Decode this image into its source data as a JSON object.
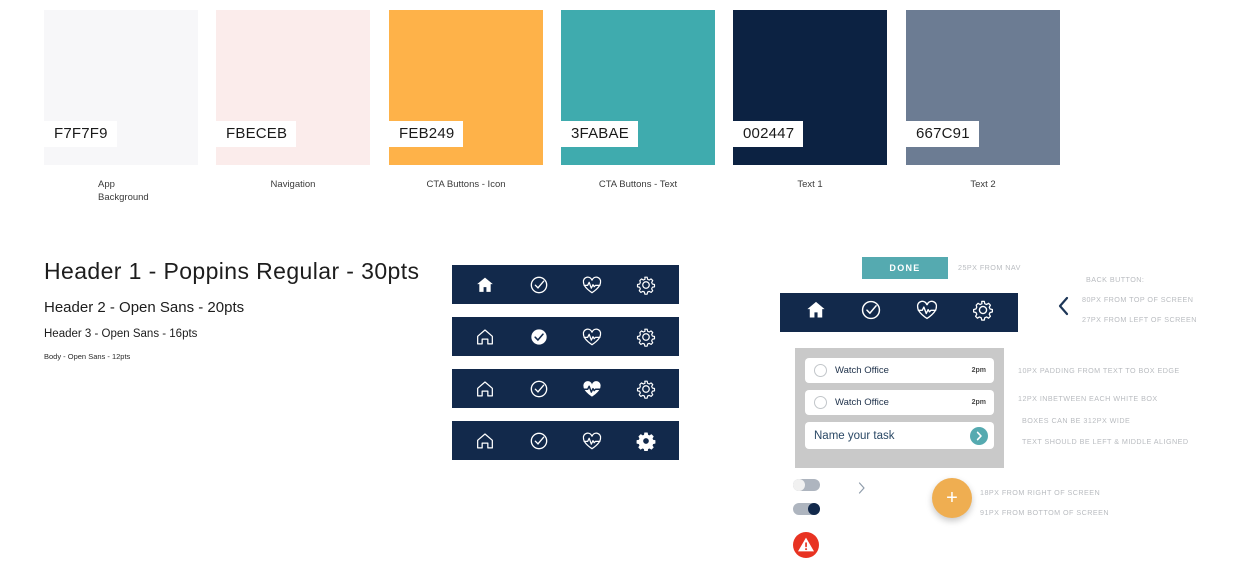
{
  "palette": {
    "swatches": [
      {
        "code": "F7F7F9",
        "hex": "#F7F7F9",
        "label": "App Background",
        "label_wrapped": true
      },
      {
        "code": "FBECEB",
        "hex": "#FBECEB",
        "label": "Navigation",
        "label_wrapped": false
      },
      {
        "code": "FEB249",
        "hex": "#FEB249",
        "label": "CTA Buttons - Icon",
        "label_wrapped": false
      },
      {
        "code": "3FABAE",
        "hex": "#3FABAE",
        "label": "CTA Buttons - Text",
        "label_wrapped": false
      },
      {
        "code": "002447",
        "hex": "#002447",
        "label": "Text 1",
        "label_wrapped": false
      },
      {
        "code": "667C91",
        "hex": "#667C91",
        "label": "Text 2",
        "label_wrapped": false
      }
    ]
  },
  "typography": {
    "h1": "Header 1  -  Poppins Regular  -  30pts",
    "h2": "Header 2  -  Open Sans  -  20pts",
    "h3": "Header 3  -  Open Sans  -  16pts",
    "body": "Body  -  Open Sans  -  12pts"
  },
  "nav_specimens": {
    "bar_color": "#12294B",
    "icons": [
      "home-icon",
      "check-circle-icon",
      "heart-pulse-icon",
      "gear-icon"
    ],
    "rows": [
      {
        "active_index": 0
      },
      {
        "active_index": 1
      },
      {
        "active_index": 2
      },
      {
        "active_index": 3
      }
    ]
  },
  "mockup": {
    "done_button": "DONE",
    "done_note": "25PX FROM NAV",
    "nav_active_index": 0,
    "back_button_notes": [
      "BACK BUTTON:",
      "80PX FROM TOP OF SCREEN",
      "27PX FROM LEFT OF SCREEN"
    ],
    "card_notes": [
      "10PX PADDING FROM TEXT TO BOX EDGE",
      "12PX INBETWEEN EACH WHITE BOX",
      "BOXES CAN BE 312PX WIDE",
      "TEXT SHOULD BE LEFT & MIDDLE ALIGNED"
    ],
    "fab_notes": [
      "18PX FROM RIGHT OF SCREEN",
      "91PX FROM BOTTOM OF SCREEN"
    ],
    "tasks": [
      {
        "title": "Watch Office",
        "time": "2pm",
        "checked": false
      },
      {
        "title": "Watch Office",
        "time": "2pm",
        "checked": false
      }
    ],
    "task_input_value": "Name your task",
    "fab_label": "+"
  },
  "colors": {
    "teal": "#3FABAE",
    "orange": "#FEB249",
    "navy": "#002447",
    "warning_red": "#E83322"
  }
}
